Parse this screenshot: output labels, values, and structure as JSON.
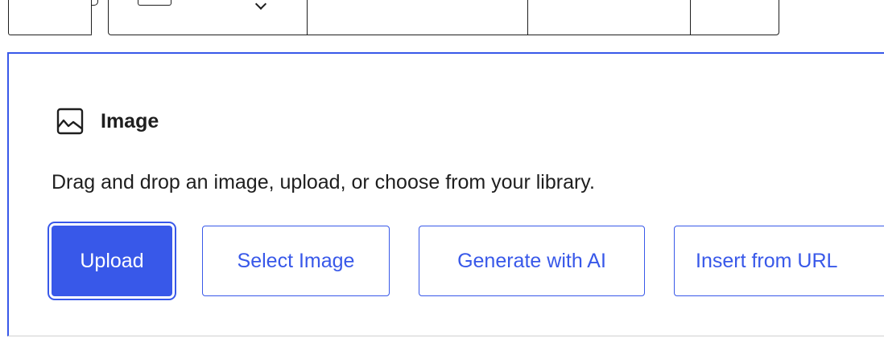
{
  "toolbar": {
    "icons": [
      "block-type-icon",
      "chevron-down-icon"
    ]
  },
  "placeholder": {
    "icon": "image-icon",
    "title": "Image",
    "instructions": "Drag and drop an image, upload, or choose from your library.",
    "accent_color": "#3858e9",
    "buttons": {
      "upload": "Upload",
      "select_image": "Select Image",
      "generate_ai": "Generate with AI",
      "insert_url": "Insert from URL"
    }
  }
}
